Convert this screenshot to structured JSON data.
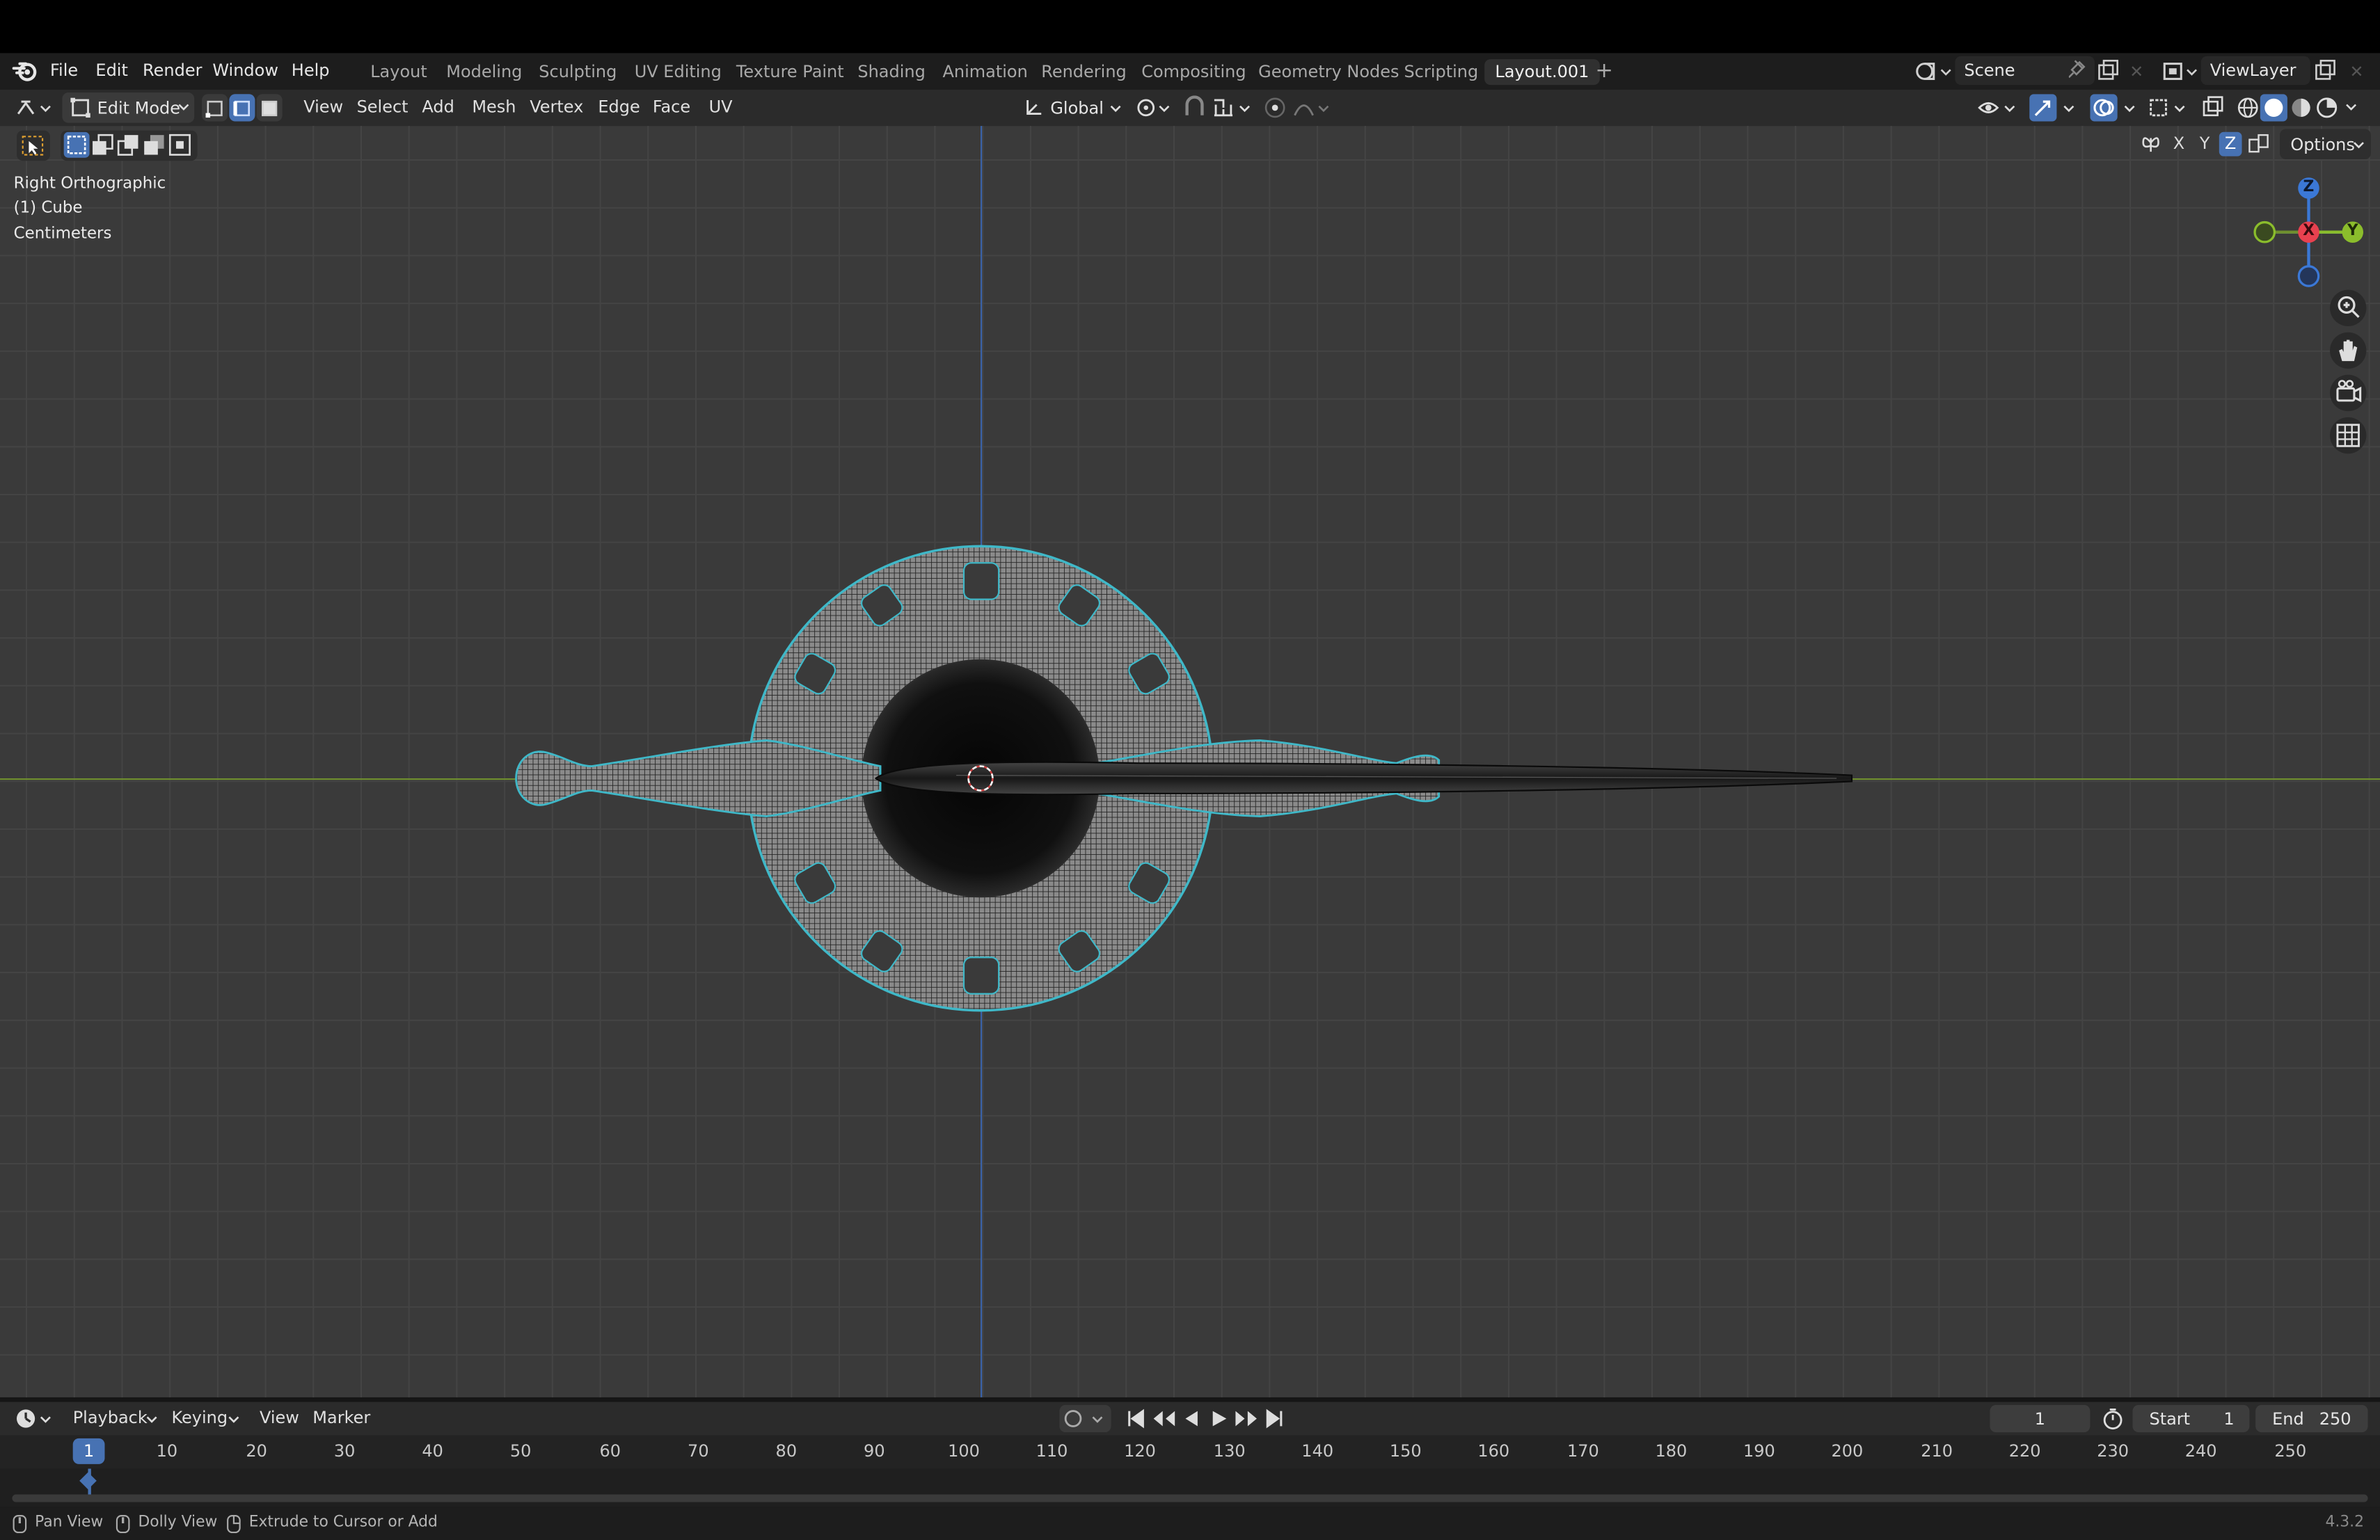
{
  "menu": [
    "File",
    "Edit",
    "Render",
    "Window",
    "Help"
  ],
  "workspaces": [
    "Layout",
    "Modeling",
    "Sculpting",
    "UV Editing",
    "Texture Paint",
    "Shading",
    "Animation",
    "Rendering",
    "Compositing",
    "Geometry Nodes",
    "Scripting",
    "Layout.001"
  ],
  "active_workspace": "Layout.001",
  "scene_name": "Scene",
  "view_layer": "ViewLayer",
  "header": {
    "mode": "Edit Mode",
    "menus": [
      "View",
      "Select",
      "Add",
      "Mesh",
      "Vertex",
      "Edge",
      "Face",
      "UV"
    ],
    "transform_orientation": "Global",
    "options_label": "Options",
    "axis_x": "X",
    "axis_y": "Y",
    "axis_z": "Z"
  },
  "viewport": {
    "view_name": "Right Orthographic",
    "object_name": "(1) Cube",
    "units": "Centimeters",
    "gizmo": {
      "z": "Z",
      "x": "X",
      "y": "Y"
    }
  },
  "timeline": {
    "menus": [
      "Playback",
      "Keying",
      "View",
      "Marker"
    ],
    "current_frame": "1",
    "start_label": "Start",
    "start_value": "1",
    "end_label": "End",
    "end_value": "250",
    "ticks": [
      "10",
      "20",
      "30",
      "40",
      "50",
      "60",
      "70",
      "80",
      "90",
      "100",
      "110",
      "120",
      "130",
      "140",
      "150",
      "160",
      "170",
      "180",
      "190",
      "200",
      "210",
      "220",
      "230",
      "240",
      "250"
    ]
  },
  "status": {
    "hint1": "Pan View",
    "hint2": "Dolly View",
    "hint3": "Extrude to Cursor or Add",
    "version": "4.3.2"
  },
  "colors": {
    "accent": "#4772b3",
    "x_axis": "#e8414f",
    "y_axis": "#8bbd2c",
    "z_axis": "#3b78d6",
    "selection_outline": "#3fb8c8"
  }
}
